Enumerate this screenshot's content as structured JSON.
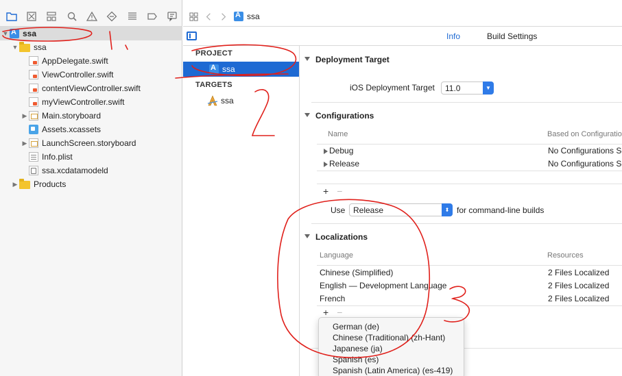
{
  "navigator": {
    "root": "ssa",
    "items": [
      {
        "label": "ssa",
        "type": "folder",
        "indent": 1,
        "disclosure": "open"
      },
      {
        "label": "AppDelegate.swift",
        "type": "swift",
        "indent": 2
      },
      {
        "label": "ViewController.swift",
        "type": "swift",
        "indent": 2
      },
      {
        "label": "contentViewController.swift",
        "type": "swift",
        "indent": 2
      },
      {
        "label": "myViewController.swift",
        "type": "swift",
        "indent": 2
      },
      {
        "label": "Main.storyboard",
        "type": "storyboard",
        "indent": 2,
        "disclosure": "closed"
      },
      {
        "label": "Assets.xcassets",
        "type": "assets",
        "indent": 2
      },
      {
        "label": "LaunchScreen.storyboard",
        "type": "storyboard",
        "indent": 2,
        "disclosure": "closed"
      },
      {
        "label": "Info.plist",
        "type": "plist",
        "indent": 2
      },
      {
        "label": "ssa.xcdatamodeld",
        "type": "model",
        "indent": 2
      },
      {
        "label": "Products",
        "type": "folder",
        "indent": 1,
        "disclosure": "closed"
      }
    ]
  },
  "jumpbar": {
    "file": "ssa"
  },
  "tabs": {
    "info": "Info",
    "build_settings": "Build Settings"
  },
  "targets_panel": {
    "project_header": "PROJECT",
    "project_item": "ssa",
    "targets_header": "TARGETS",
    "target_item": "ssa"
  },
  "deployment": {
    "title": "Deployment Target",
    "label": "iOS Deployment Target",
    "value": "11.0"
  },
  "configurations": {
    "title": "Configurations",
    "col_name": "Name",
    "col_based": "Based on Configuration File",
    "rows": [
      {
        "name": "Debug",
        "based": "No Configurations Set"
      },
      {
        "name": "Release",
        "based": "No Configurations Set"
      }
    ],
    "use_label": "Use",
    "use_value": "Release",
    "use_suffix": "for command-line builds"
  },
  "localizations": {
    "title": "Localizations",
    "col_language": "Language",
    "col_resources": "Resources",
    "rows": [
      {
        "language": "Chinese (Simplified)",
        "resources": "2 Files Localized"
      },
      {
        "language": "English — Development Language",
        "resources": "2 Files Localized"
      },
      {
        "language": "French",
        "resources": "2 Files Localized"
      }
    ]
  },
  "menu": {
    "items": [
      "German (de)",
      "Chinese (Traditional) (zh-Hant)",
      "Japanese (ja)",
      "Spanish (es)",
      "Spanish (Latin America) (es-419)"
    ]
  },
  "colors": {
    "accent": "#1e6ad3",
    "annotation": "#e0201b",
    "selection": "#1e6ad3"
  }
}
